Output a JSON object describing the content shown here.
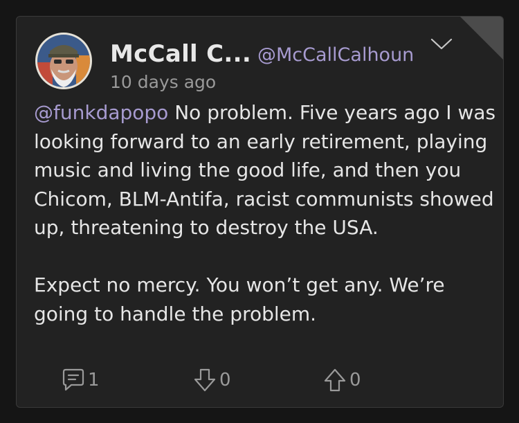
{
  "post": {
    "author": {
      "display_name": "McCall C...",
      "handle": "@McCallCalhoun",
      "avatar_icon": "user-avatar"
    },
    "timestamp": "10 days ago",
    "mention": "@funkdapopo",
    "line1_rest": " No problem. Five years ago I was looking forward to an early retirement, playing music and living the good life, and then you Chicom, BLM-Antifa, racist communists showed up, threatening to destroy the USA.",
    "paragraph2": "Expect no mercy. You won’t get any. We’re going to handle the problem."
  },
  "actions": {
    "comments": {
      "icon": "comment-icon",
      "count": "1"
    },
    "downvotes": {
      "icon": "downvote-icon",
      "count": "0"
    },
    "upvotes": {
      "icon": "upvote-icon",
      "count": "0"
    }
  },
  "colors": {
    "background": "#151515",
    "card": "#222222",
    "accent": "#a79bd0",
    "text": "#e6e6e6",
    "muted": "#9a9a9a"
  }
}
